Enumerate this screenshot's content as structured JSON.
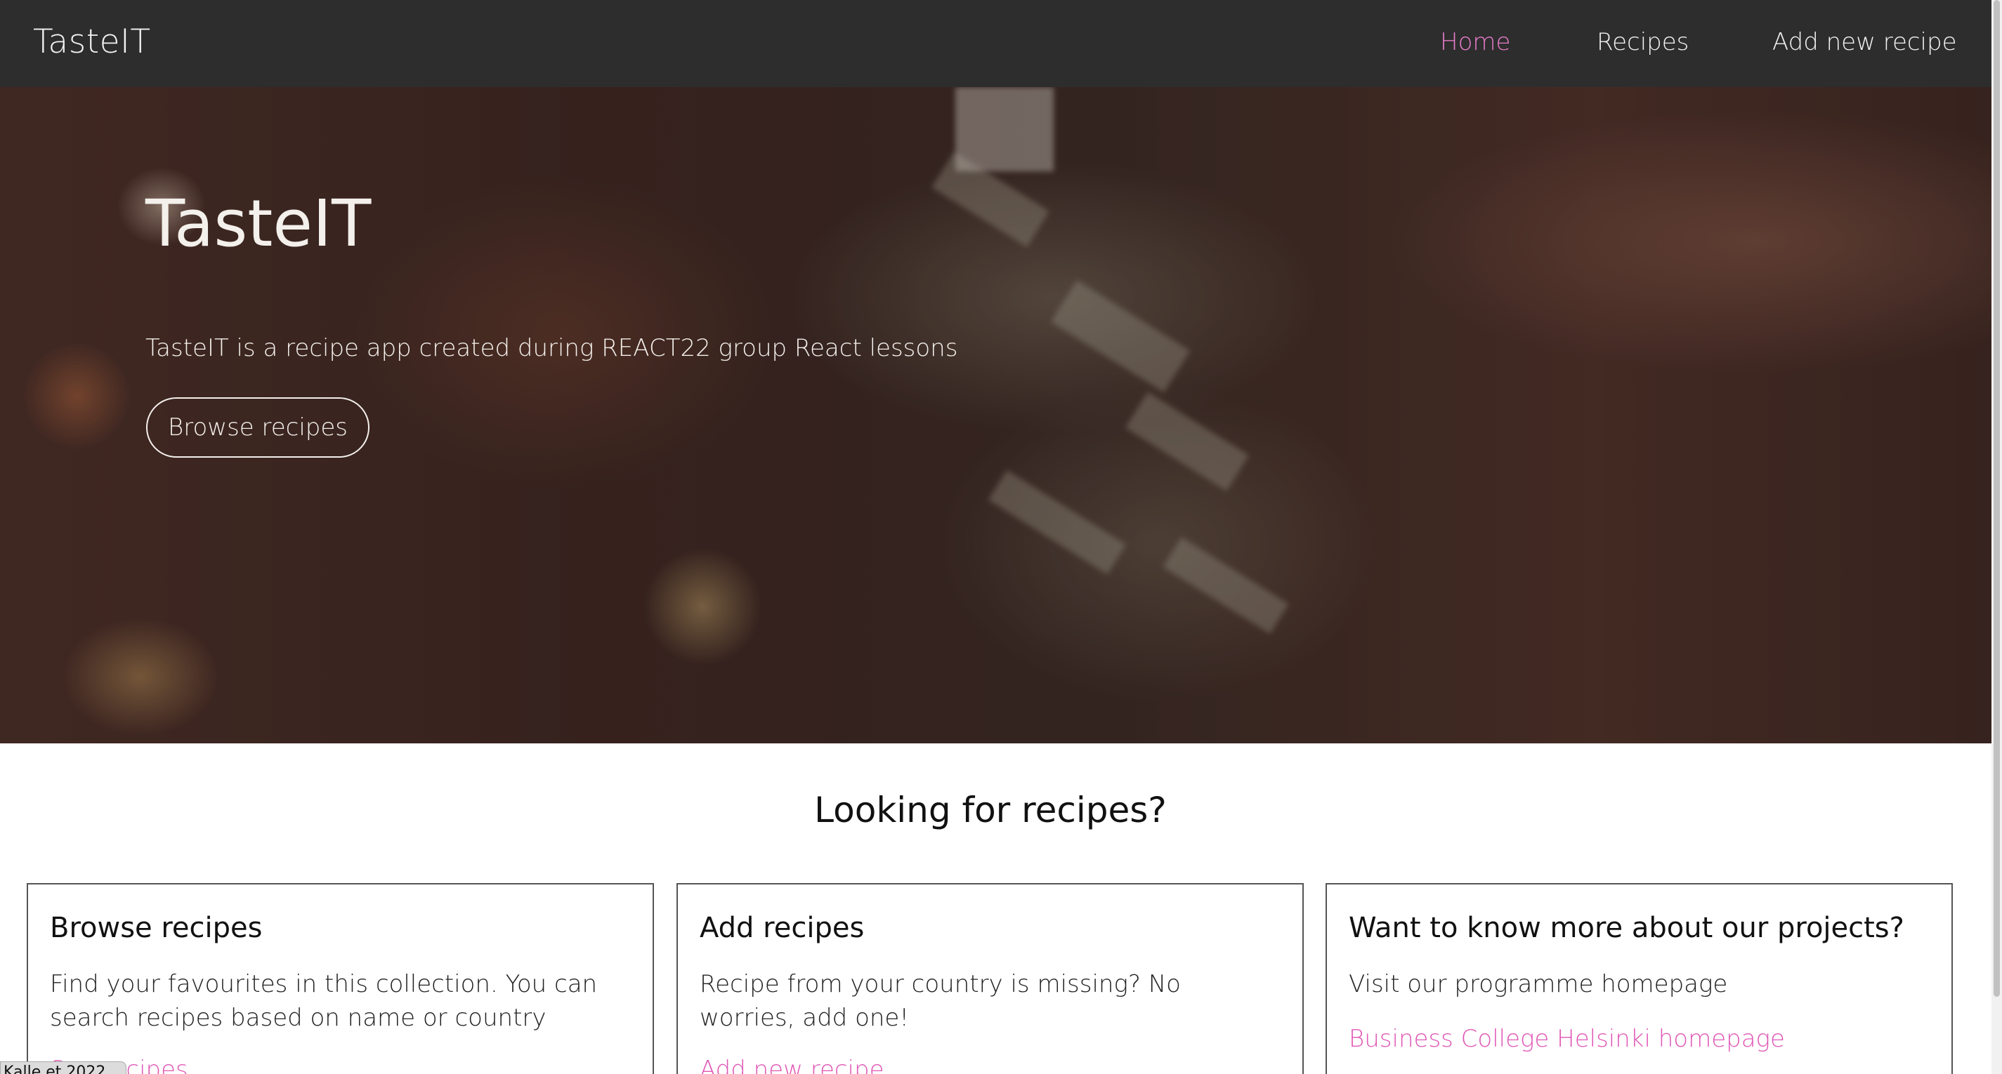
{
  "navbar": {
    "brand": "TasteIT",
    "links": [
      {
        "label": "Home",
        "active": true
      },
      {
        "label": "Recipes",
        "active": false
      },
      {
        "label": "Add new recipe",
        "active": false
      }
    ],
    "active_color": "#e57bc8",
    "background": "#2d2d2d"
  },
  "hero": {
    "title": "TasteIT",
    "text": "TasteIT is a recipe app created during REACT22 group React lessons",
    "button_label": "Browse recipes"
  },
  "section": {
    "title": "Looking for recipes?"
  },
  "cards": [
    {
      "title": "Browse recipes",
      "text": "Find your favourites in this collection. You can search recipes based on name or country",
      "link": "See recipes"
    },
    {
      "title": "Add recipes",
      "text": "Recipe from your country is missing? No worries, add one!",
      "link": "Add new recipe"
    },
    {
      "title": "Want to know more about our projects?",
      "text": "Visit our programme homepage",
      "link": "Business College Helsinki homepage"
    }
  ],
  "footer": {
    "text": "Kalle et 2022"
  },
  "colors": {
    "link": "#e057b5",
    "text": "#111111"
  }
}
